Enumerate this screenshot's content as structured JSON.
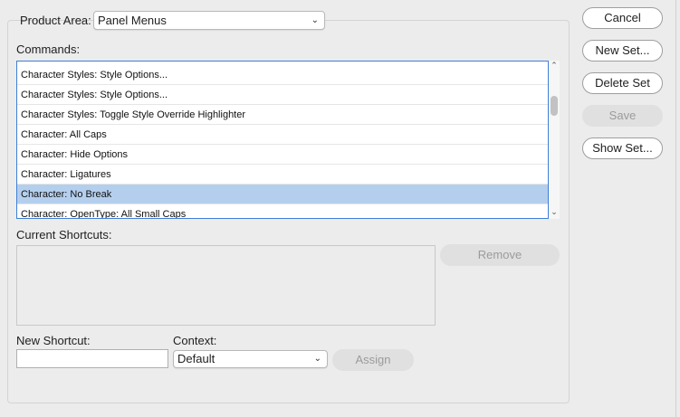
{
  "product_area": {
    "label": "Product Area:",
    "value": "Panel Menus"
  },
  "commands": {
    "label": "Commands:",
    "items": [
      {
        "text": "Character Styles: Style Options...",
        "selected": false
      },
      {
        "text": "Character Styles: Style Options...",
        "selected": false
      },
      {
        "text": "Character Styles: Toggle Style Override Highlighter",
        "selected": false
      },
      {
        "text": "Character: All Caps",
        "selected": false
      },
      {
        "text": "Character: Hide Options",
        "selected": false
      },
      {
        "text": "Character: Ligatures",
        "selected": false
      },
      {
        "text": "Character: No Break",
        "selected": true
      },
      {
        "text": "Character: OpenType: All Small Caps",
        "selected": false
      }
    ]
  },
  "current_shortcuts": {
    "label": "Current Shortcuts:",
    "remove_label": "Remove"
  },
  "new_shortcut": {
    "label": "New Shortcut:",
    "value": ""
  },
  "context": {
    "label": "Context:",
    "value": "Default"
  },
  "assign_label": "Assign",
  "buttons": {
    "cancel": "Cancel",
    "new_set": "New Set...",
    "delete_set": "Delete Set",
    "save": "Save",
    "show_set": "Show Set..."
  },
  "colors": {
    "selection": "#b4cfee",
    "focus_border": "#3e7fd6",
    "background": "#ececec"
  }
}
